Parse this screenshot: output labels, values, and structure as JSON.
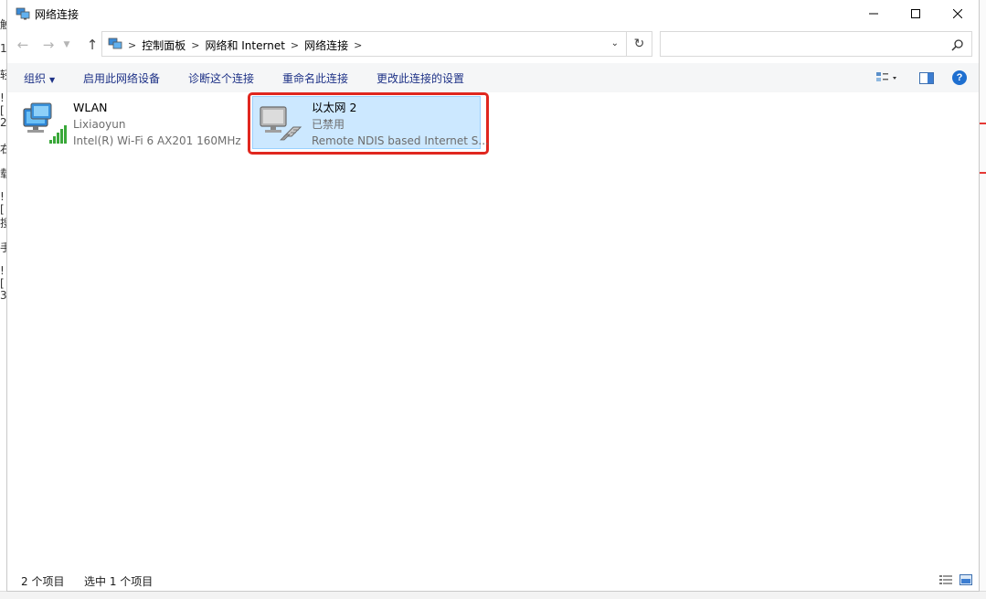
{
  "window": {
    "title": "网络连接"
  },
  "address": {
    "breadcrumbs": [
      "控制面板",
      "网络和 Internet",
      "网络连接"
    ],
    "search_placeholder": ""
  },
  "toolbar": {
    "organize": "组织",
    "items": [
      "启用此网络设备",
      "诊断这个连接",
      "重命名此连接",
      "更改此连接的设置"
    ]
  },
  "connections": [
    {
      "name": "WLAN",
      "status": "Lixiaoyun",
      "device": "Intel(R) Wi-Fi 6 AX201 160MHz",
      "selected": false,
      "icon": "wifi-network-icon"
    },
    {
      "name": "以太网 2",
      "status": "已禁用",
      "device": "Remote NDIS based Internet S...",
      "selected": true,
      "icon": "ethernet-disabled-icon"
    }
  ],
  "status": {
    "count": "2 个项目",
    "selected": "选中 1 个项目"
  },
  "background_text": [
    "触",
    "1",
    "轻",
    "![",
    "2",
    "右",
    "载",
    "![",
    "搜",
    "手",
    "![",
    "3"
  ],
  "colors": {
    "toolbar_text": "#1e3287",
    "selection_bg": "#cce8ff",
    "highlight_ring": "#e0271f",
    "help_icon": "#1e6fd0"
  }
}
